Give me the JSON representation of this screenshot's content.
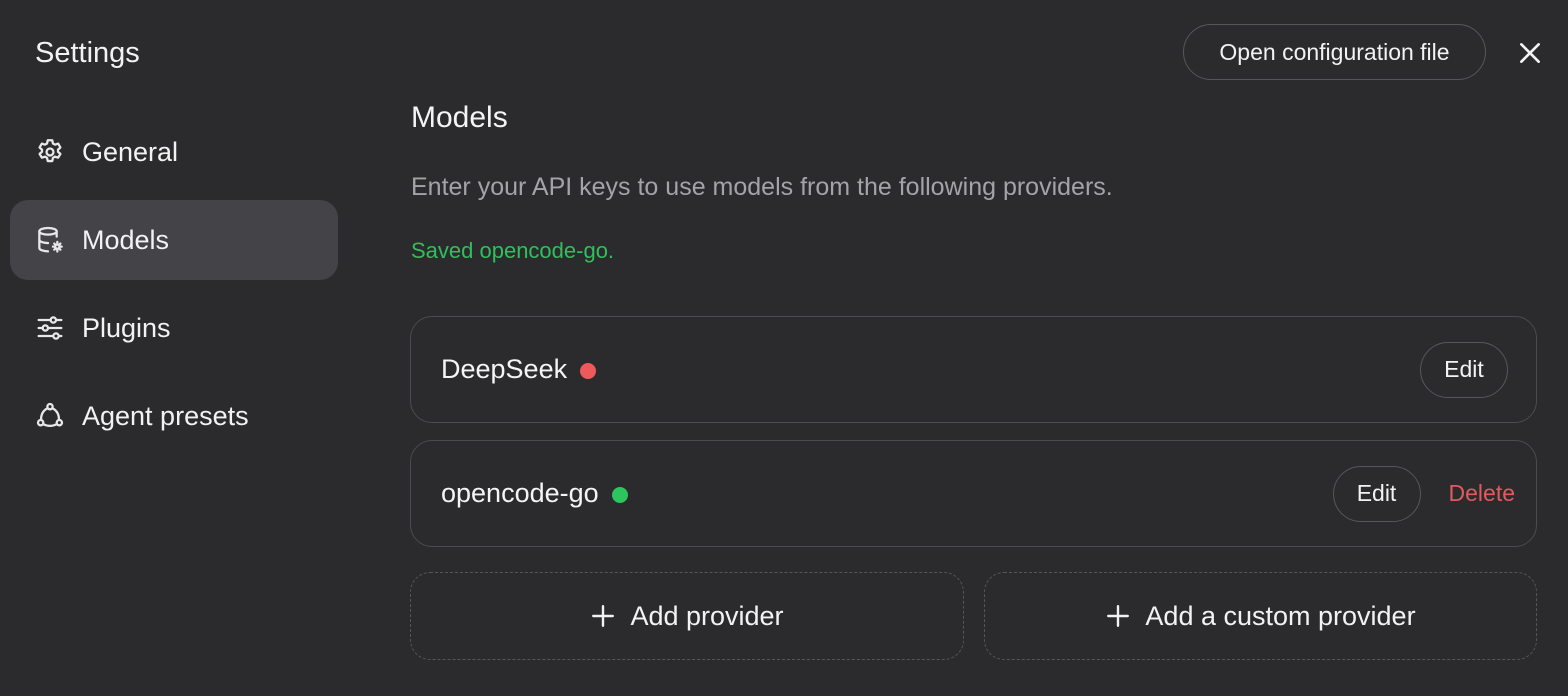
{
  "sidebar": {
    "title": "Settings",
    "items": [
      {
        "label": "General",
        "icon": "gear-icon",
        "active": false
      },
      {
        "label": "Models",
        "icon": "database-gear-icon",
        "active": true
      },
      {
        "label": "Plugins",
        "icon": "sliders-icon",
        "active": false
      },
      {
        "label": "Agent presets",
        "icon": "agent-network-icon",
        "active": false
      }
    ]
  },
  "header": {
    "open_config_label": "Open configuration file",
    "close_icon": "close-icon"
  },
  "main": {
    "title": "Models",
    "description": "Enter your API keys to use models from the following providers.",
    "status_message": "Saved opencode-go.",
    "providers": [
      {
        "name": "DeepSeek",
        "status_color": "#f0595c",
        "edit_label": "Edit"
      },
      {
        "name": "opencode-go",
        "status_color": "#2dc55e",
        "edit_label": "Edit",
        "delete_label": "Delete"
      }
    ],
    "add_provider_label": "Add provider",
    "add_custom_provider_label": "Add a custom provider"
  },
  "colors": {
    "background": "#2b2b2d",
    "active_nav": "#434348",
    "success": "#2fbf5c",
    "danger": "#e05a5f"
  }
}
